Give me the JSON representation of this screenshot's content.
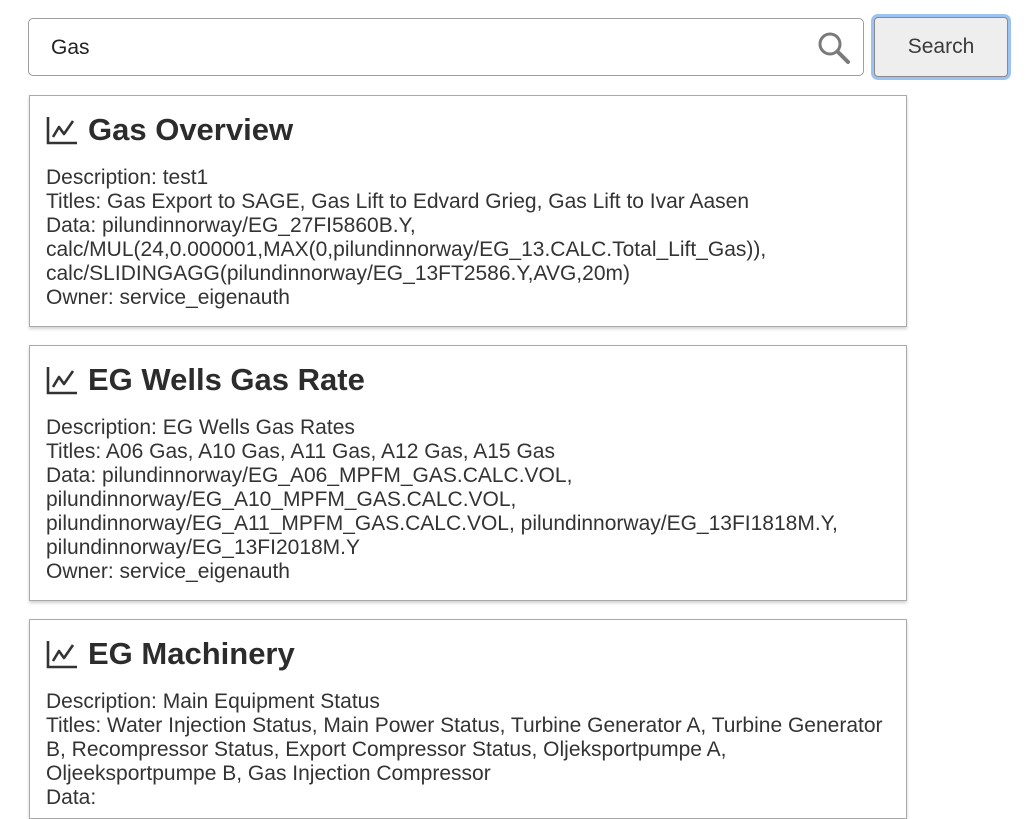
{
  "search": {
    "value": "Gas",
    "button_label": "Search"
  },
  "results": [
    {
      "title": "Gas Overview",
      "description": "Description: test1",
      "titles": "Titles: Gas Export to SAGE, Gas Lift to Edvard Grieg, Gas Lift to Ivar Aasen",
      "data": "Data: pilundinnorway/EG_27FI5860B.Y, calc/MUL(24,0.000001,MAX(0,pilundinnorway/EG_13.CALC.Total_Lift_Gas)), calc/SLIDINGAGG(pilundinnorway/EG_13FT2586.Y,AVG,20m)",
      "owner": "Owner: service_eigenauth"
    },
    {
      "title": "EG Wells Gas Rate",
      "description": "Description: EG Wells Gas Rates",
      "titles": "Titles: A06 Gas, A10 Gas, A11 Gas, A12 Gas, A15 Gas",
      "data": "Data: pilundinnorway/EG_A06_MPFM_GAS.CALC.VOL, pilundinnorway/EG_A10_MPFM_GAS.CALC.VOL, pilundinnorway/EG_A11_MPFM_GAS.CALC.VOL, pilundinnorway/EG_13FI1818M.Y, pilundinnorway/EG_13FI2018M.Y",
      "owner": "Owner: service_eigenauth"
    },
    {
      "title": "EG Machinery",
      "description": "Description: Main Equipment Status",
      "titles": "Titles: Water Injection Status, Main Power Status, Turbine Generator A, Turbine Generator B, Recompressor Status, Export Compressor Status, Oljeksportpumpe A, Oljeeksportpumpe B, Gas Injection Compressor",
      "data": "Data:",
      "owner": ""
    }
  ],
  "icons": {
    "search": "search-icon",
    "result": "line-chart-icon"
  },
  "colors": {
    "focus_ring": "#9cc2f4",
    "button_bg": "#eeeeee",
    "card_border": "#a9a9a9"
  }
}
